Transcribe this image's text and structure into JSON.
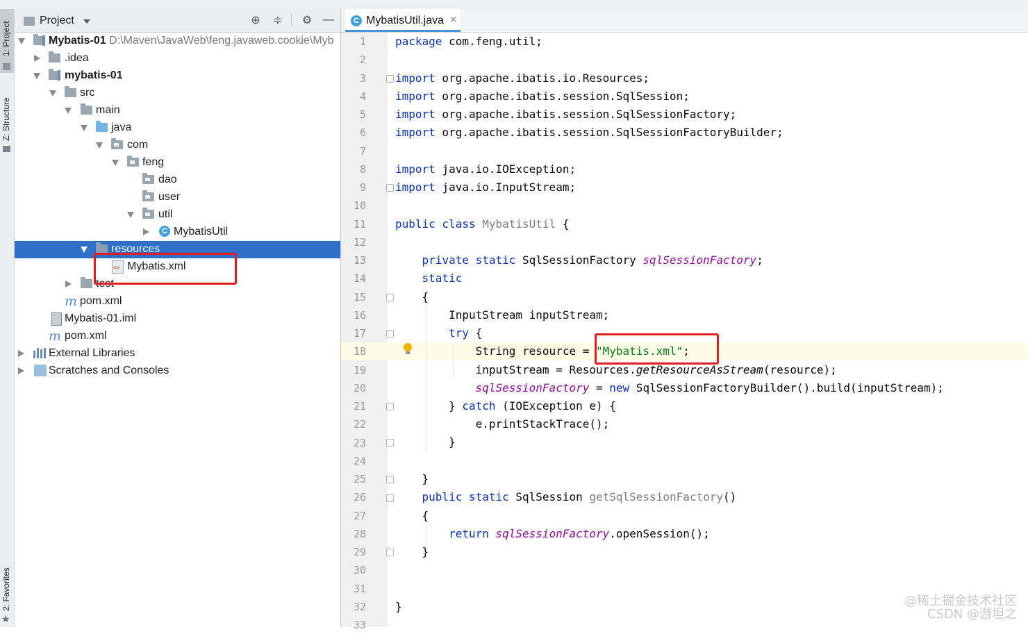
{
  "left_strip": {
    "tabs": [
      {
        "label": "1: Project"
      },
      {
        "label": "Z: Structure"
      },
      {
        "label": "2: Favorites"
      }
    ]
  },
  "project_panel": {
    "title": "Project",
    "header_icons": [
      "locate-icon",
      "collapse-icon",
      "gear-icon",
      "minimize-icon"
    ],
    "tree": [
      {
        "label": "Mybatis-01",
        "path": "D:\\Maven\\JavaWeb\\feng.javaweb.cookie\\Myb"
      },
      {
        "label": ".idea"
      },
      {
        "label": "mybatis-01"
      },
      {
        "label": "src"
      },
      {
        "label": "main"
      },
      {
        "label": "java"
      },
      {
        "label": "com"
      },
      {
        "label": "feng"
      },
      {
        "label": "dao"
      },
      {
        "label": "user"
      },
      {
        "label": "util"
      },
      {
        "label": "MybatisUtil"
      },
      {
        "label": "resources"
      },
      {
        "label": "Mybatis.xml"
      },
      {
        "label": "test"
      },
      {
        "label": "pom.xml"
      },
      {
        "label": "Mybatis-01.iml"
      },
      {
        "label": "pom.xml"
      },
      {
        "label": "External Libraries"
      },
      {
        "label": "Scratches and Consoles"
      }
    ]
  },
  "editor": {
    "tab_label": "MybatisUtil.java",
    "active_line": 18,
    "lines": [
      "1",
      "2",
      "3",
      "4",
      "5",
      "6",
      "7",
      "8",
      "9",
      "10",
      "11",
      "12",
      "13",
      "14",
      "15",
      "16",
      "17",
      "18",
      "19",
      "20",
      "21",
      "22",
      "23",
      "24",
      "25",
      "26",
      "27",
      "28",
      "29",
      "30",
      "31",
      "32",
      "33"
    ],
    "code": {
      "l1a": "package",
      "l1b": " com.feng.util;",
      "imp": "import",
      "l3": " org.apache.ibatis.io.Resources;",
      "l4": " org.apache.ibatis.session.SqlSession;",
      "l5": " org.apache.ibatis.session.SqlSessionFactory;",
      "l6": " org.apache.ibatis.session.SqlSessionFactoryBuilder;",
      "l8": " java.io.IOException;",
      "l9": " java.io.InputStream;",
      "l11a": "public class",
      "l11b": " MybatisUtil",
      "l11c": " {",
      "l13a": "    private static",
      "l13b": " SqlSessionFactory ",
      "l13c": "sqlSessionFactory",
      "l13d": ";",
      "l14": "    static",
      "l15": "    {",
      "l16": "        InputStream inputStream;",
      "l17a": "        try",
      "l17b": " {",
      "l18a": "            String resource = ",
      "l18b": "\"Mybatis.xml\"",
      "l18c": ";",
      "l19a": "            inputStream = Resources.",
      "l19b": "getResourceAsStream",
      "l19c": "(resource);",
      "l20a": "            ",
      "l20b": "sqlSessionFactory",
      "l20c": " = ",
      "l20d": "new",
      "l20e": " SqlSessionFactoryBuilder().build(inputStream);",
      "l21a": "        } ",
      "l21b": "catch",
      "l21c": " (IOException e) {",
      "l22": "            e.printStackTrace();",
      "l23": "        }",
      "l25": "    }",
      "l26a": "    public static",
      "l26b": " SqlSession ",
      "l26c": "getSqlSessionFactory",
      "l26d": "()",
      "l27": "    {",
      "l28a": "        return ",
      "l28b": "sqlSessionFactory",
      "l28c": ".openSession();",
      "l29": "    }",
      "l32": "}"
    }
  },
  "watermark": {
    "line1": "@稀土掘金技术社区",
    "line2": "CSDN @游坦之"
  },
  "colors": {
    "selection": "#2f6fc9",
    "keyword": "#0b33a8",
    "string": "#067d17",
    "field": "#871094",
    "highlight_box": "#e21e1e"
  }
}
